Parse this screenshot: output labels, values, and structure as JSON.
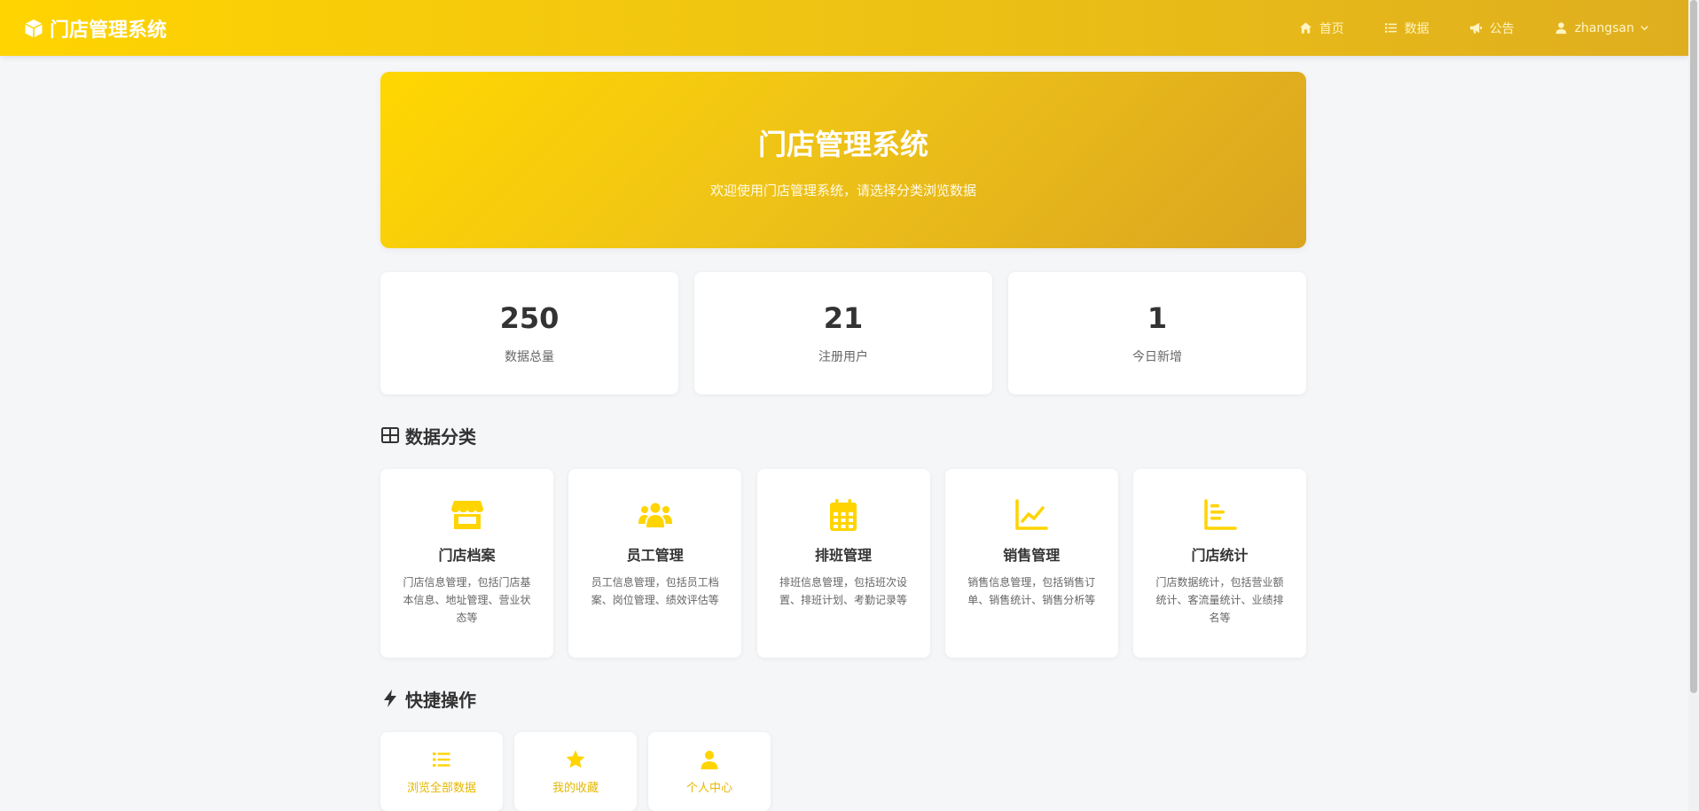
{
  "colors": {
    "accent": "#FFD700",
    "accent_dark": "#DAA520",
    "text": "#333333"
  },
  "navbar": {
    "brand": "门店管理系统",
    "brand_icon": "cube-icon",
    "links": [
      {
        "label": "首页",
        "icon": "home-icon"
      },
      {
        "label": "数据",
        "icon": "list-icon"
      },
      {
        "label": "公告",
        "icon": "bullhorn-icon"
      }
    ],
    "user": {
      "name": "zhangsan",
      "icon": "user-icon"
    }
  },
  "hero": {
    "title": "门店管理系统",
    "subtitle": "欢迎使用门店管理系统，请选择分类浏览数据"
  },
  "stats": [
    {
      "value": "250",
      "label": "数据总量"
    },
    {
      "value": "21",
      "label": "注册用户"
    },
    {
      "value": "1",
      "label": "今日新增"
    }
  ],
  "categories_section": {
    "title": "数据分类",
    "icon": "table-icon",
    "items": [
      {
        "title": "门店档案",
        "desc": "门店信息管理，包括门店基本信息、地址管理、营业状态等",
        "icon": "store-icon"
      },
      {
        "title": "员工管理",
        "desc": "员工信息管理，包括员工档案、岗位管理、绩效评估等",
        "icon": "users-icon"
      },
      {
        "title": "排班管理",
        "desc": "排班信息管理，包括班次设置、排班计划、考勤记录等",
        "icon": "calendar-icon"
      },
      {
        "title": "销售管理",
        "desc": "销售信息管理，包括销售订单、销售统计、销售分析等",
        "icon": "line-chart-icon"
      },
      {
        "title": "门店统计",
        "desc": "门店数据统计，包括营业额统计、客流量统计、业绩排名等",
        "icon": "bar-chart-icon"
      }
    ]
  },
  "quick_section": {
    "title": "快捷操作",
    "icon": "bolt-icon",
    "items": [
      {
        "label": "浏览全部数据",
        "icon": "list-icon"
      },
      {
        "label": "我的收藏",
        "icon": "star-icon"
      },
      {
        "label": "个人中心",
        "icon": "user-icon"
      }
    ]
  }
}
